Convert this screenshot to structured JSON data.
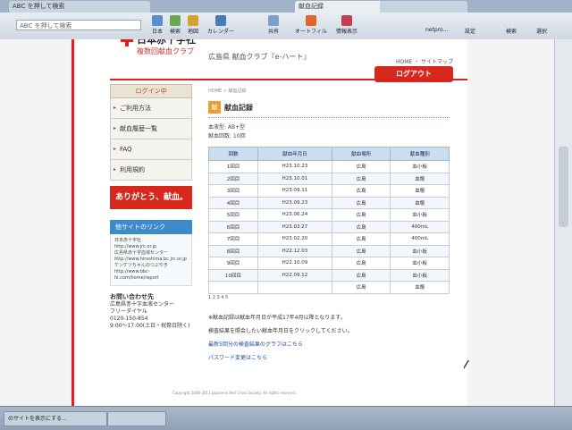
{
  "browser": {
    "tabs": [
      "ABC を押して検索",
      "献血記録",
      ""
    ],
    "search_placeholder": "ABC を押して検索",
    "toolbar_items": [
      "日本",
      "検索",
      "地図",
      "カレンダー",
      "共有",
      "オートフィル",
      "情報表示"
    ],
    "right_tools": [
      "netpro...",
      "設定",
      "検索",
      "選択"
    ]
  },
  "site": {
    "org_name": "日本赤十字社",
    "club_name": "複数回献血クラブ",
    "site_title": "広島県 献血クラブ『e-ハート』",
    "top_links": "HOME ・ サイトマップ",
    "logout_label": "ログアウト"
  },
  "sidebar": {
    "login_title": "ログイン中",
    "items": [
      "ご利用方法",
      "献血履歴一覧",
      "FAQ",
      "利用規約"
    ],
    "thanks": "ありがとう、献血。",
    "links_title": "他サイトのリンク",
    "links": [
      "日本赤十字社",
      "http://www.jrc.or.jp",
      "広島県赤十字血液センター",
      "http://www.hiroshima.bc.jrc.or.jp",
      "ケンケツちゃんのつぶやき",
      "http://www.bbc-hi.com/home/report"
    ],
    "contact_title": "お問い合わせ先",
    "contact_lines": [
      "広島県赤十字血液センター",
      "フリーダイヤル",
      "0120-150-854",
      "9:00〜17:00(土日・祝祭日除く)"
    ]
  },
  "main": {
    "breadcrumb": "HOME > 献血記録",
    "title": "献血記録",
    "blood_type": "血液型: AB+型",
    "donation_count": "献血回数: 10回",
    "columns": [
      "回数",
      "献血年月日",
      "献血場所",
      "献血種別"
    ],
    "rows": [
      [
        "1回目",
        "H23.10.23",
        "広島",
        "血小板"
      ],
      [
        "2回目",
        "H23.10.01",
        "広島",
        "血漿"
      ],
      [
        "3回目",
        "H23.09.11",
        "広島",
        "血漿"
      ],
      [
        "4回目",
        "H23.09.23",
        "広島",
        "血漿"
      ],
      [
        "5回目",
        "H23.06.24",
        "広島",
        "血小板"
      ],
      [
        "6回目",
        "H23.03.27",
        "広島",
        "400mL"
      ],
      [
        "7回目",
        "H23.02.20",
        "広島",
        "400mL"
      ],
      [
        "8回目",
        "H22.12.03",
        "広島",
        "血小板"
      ],
      [
        "9回目",
        "H22.10.09",
        "広島",
        "血小板"
      ],
      [
        "10回目",
        "H22.09.12",
        "広島",
        "血小板"
      ],
      [
        "",
        "",
        "広島",
        "血漿"
      ]
    ],
    "pager": "1 2 3 4 5",
    "note": "※献血記録は献血年月日が平成17年4月以降となります。",
    "instruction": "検査結果を照会したい献血年月日をクリックしてください。",
    "link_latest": "最新5回分の検査結果のグラフはこちら",
    "link_password": "パスワード変更はこちら",
    "footer": "Copyright 2006-2011 Japanese Red Cross Society. All rights reserved."
  },
  "taskbar": {
    "items": [
      "のサイトを表示にする...",
      ""
    ]
  }
}
